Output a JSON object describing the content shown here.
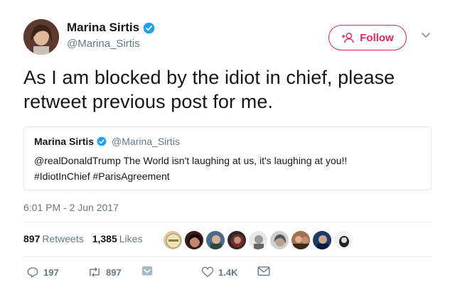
{
  "author": {
    "name": "Marina Sirtis",
    "handle": "@Marina_Sirtis"
  },
  "follow_label": "Follow",
  "tweet": {
    "line1": "As I am blocked by the idiot in chief, please",
    "line2": "retweet previous post for me."
  },
  "quote": {
    "name": "Marina Sirtis",
    "handle": "@Marina_Sirtis",
    "line1": "@realDonaldTrump The World isn't laughing at us, it's laughing at you!!",
    "line2": "#IdiotInChief #ParisAgreement"
  },
  "timestamp": "6:01 PM - 2 Jun 2017",
  "stats": {
    "retweets_count": "897",
    "retweets_label": "Retweets",
    "likes_count": "1,385",
    "likes_label": "Likes"
  },
  "actions": {
    "replies": "197",
    "retweets": "897",
    "likes": "1.4K"
  },
  "colors": {
    "accent": "#e0245e",
    "verified": "#1da1f2",
    "secondary_text": "#657786"
  },
  "icons": [
    "verified-badge-icon",
    "follow-person-icon",
    "chevron-down-icon",
    "reply-icon",
    "retweet-icon",
    "dm-icon",
    "like-icon",
    "mail-icon"
  ]
}
